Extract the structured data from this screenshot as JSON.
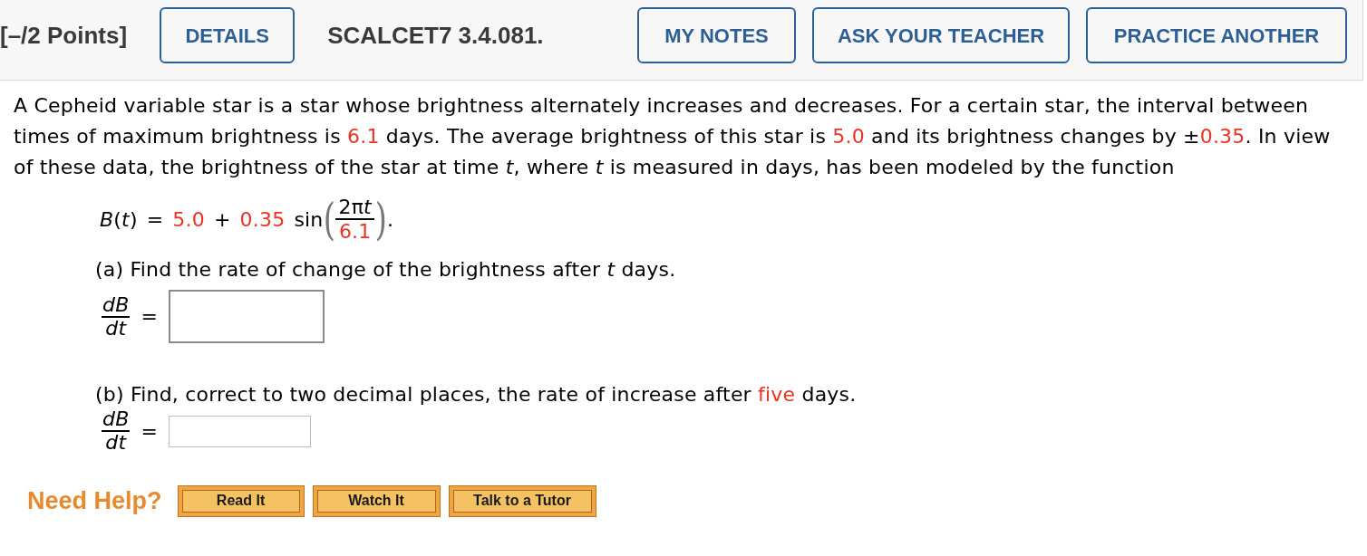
{
  "header": {
    "points": "[–/2 Points]",
    "details_button": "DETAILS",
    "problem_id": "SCALCET7 3.4.081.",
    "actions": [
      "MY NOTES",
      "ASK YOUR TEACHER",
      "PRACTICE ANOTHER"
    ]
  },
  "intro": [
    {
      "text": "A Cepheid variable star is a star whose brightness alternately increases and decreases. For a certain star, the interval between times of maximum brightness is ",
      "highlighted": false
    },
    {
      "text": "6.1",
      "highlighted": true
    },
    {
      "text": " days. The average brightness of this star is ",
      "highlighted": false
    },
    {
      "text": "5.0",
      "highlighted": true
    },
    {
      "text": " and its brightness changes by ±",
      "highlighted": false
    },
    {
      "text": "0.35",
      "highlighted": true
    },
    {
      "text": ". In view of these data, the brightness of the star at time *t*, where *t* is measured in days, has been modeled by the function",
      "highlighted": false
    }
  ],
  "formula": [
    {
      "kind": "text",
      "text": "*B*(*t*)",
      "highlighted": false
    },
    {
      "kind": "text",
      "text": "=",
      "highlighted": false
    },
    {
      "kind": "text",
      "text": "5.0",
      "highlighted": true
    },
    {
      "kind": "text",
      "text": "+",
      "highlighted": false
    },
    {
      "kind": "text",
      "text": "0.35",
      "highlighted": true
    },
    {
      "kind": "text",
      "text": "sin",
      "highlighted": false
    },
    {
      "kind": "fraction",
      "open": "(",
      "numerator": "2π",
      "numerator_variable": "t",
      "denominator": "6.1",
      "denominator_highlighted": true,
      "close": ")"
    },
    {
      "kind": "punctuation",
      "text": ".",
      "highlighted": false
    }
  ],
  "parts": [
    {
      "question": [
        {
          "text": "(a) Find the rate of change of the brightness after *t* days.",
          "highlighted": false
        }
      ],
      "answer": {
        "numerator": "dB",
        "denominator": "dt",
        "equals": "=",
        "kind": "expression"
      }
    },
    {
      "question": [
        {
          "text": "(b) Find, correct to two decimal places, the rate of increase after ",
          "highlighted": false
        },
        {
          "text": "five",
          "highlighted": true
        },
        {
          "text": " days.",
          "highlighted": false
        }
      ],
      "answer": {
        "numerator": "dB",
        "denominator": "dt",
        "equals": "=",
        "kind": "number"
      }
    }
  ],
  "help": {
    "label": "Need Help?",
    "buttons": [
      "Read It",
      "Watch It",
      "Talk to a Tutor"
    ]
  }
}
